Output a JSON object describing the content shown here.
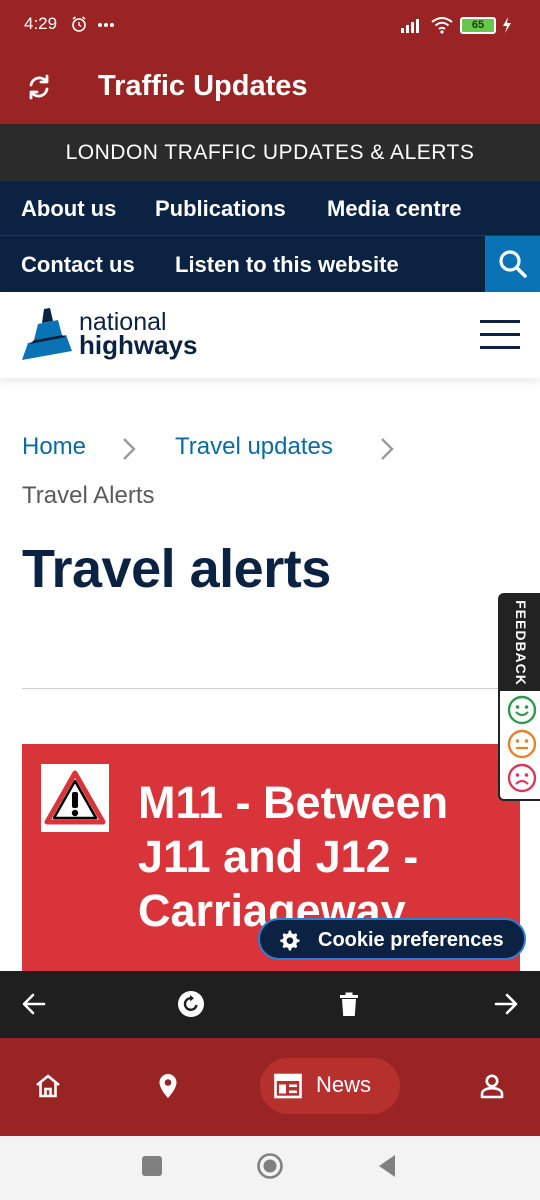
{
  "status_bar": {
    "time": "4:29",
    "battery": "65"
  },
  "app_bar": {
    "title": "Traffic Updates"
  },
  "banner": {
    "text": "LONDON TRAFFIC UPDATES & ALERTS"
  },
  "nav": {
    "items": [
      {
        "label": "About us"
      },
      {
        "label": "Publications"
      },
      {
        "label": "Media centre"
      },
      {
        "label": "Contact us"
      },
      {
        "label": "Listen to this website"
      }
    ]
  },
  "logo": {
    "line1": "national",
    "line2": "highways"
  },
  "breadcrumb": {
    "home": "Home",
    "travel_updates": "Travel updates",
    "current": "Travel Alerts"
  },
  "page": {
    "title": "Travel alerts"
  },
  "alert": {
    "title": "M11 - Between J11 and J12 - Carriageway"
  },
  "feedback": {
    "label": "FEEDBACK"
  },
  "cookie": {
    "label": "Cookie preferences"
  },
  "bottom_nav": {
    "news_label": "News"
  },
  "colors": {
    "brand_red": "#9a2424",
    "navy": "#0b2243",
    "alert_red": "#d8343a",
    "link_blue": "#0a6aa6"
  }
}
